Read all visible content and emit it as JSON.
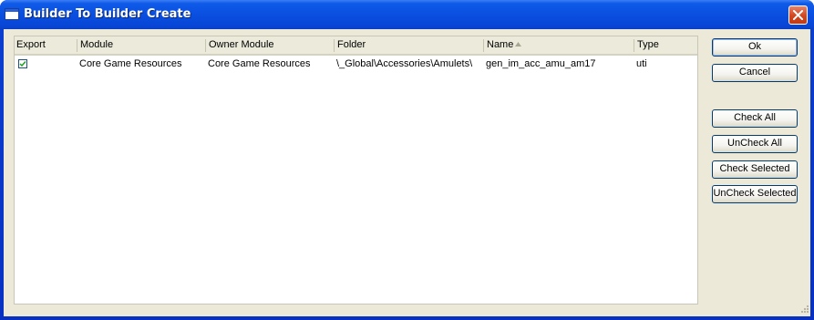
{
  "window": {
    "title": "Builder To Builder Create"
  },
  "list": {
    "columns": [
      "Export",
      "Module",
      "Owner Module",
      "Folder",
      "Name",
      "Type"
    ],
    "sorted_column": "Name",
    "rows": [
      {
        "export": true,
        "module": "Core Game Resources",
        "owner_module": "Core Game Resources",
        "folder": "\\_Global\\Accessories\\Amulets\\",
        "name": "gen_im_acc_amu_am17",
        "type": "uti"
      }
    ]
  },
  "buttons": {
    "ok": "Ok",
    "cancel": "Cancel",
    "check_all": "Check All",
    "uncheck_all": "UnCheck All",
    "check_selected": "Check Selected",
    "uncheck_selected": "UnCheck Selected"
  },
  "colors": {
    "titlebar": "#0a4fe0",
    "dialog_bg": "#ece9d8",
    "close": "#d2471f"
  },
  "icons": {
    "title": "window-icon",
    "close": "close-x-icon",
    "sort": "sort-ascending-icon",
    "grip": "resize-grip-icon"
  }
}
